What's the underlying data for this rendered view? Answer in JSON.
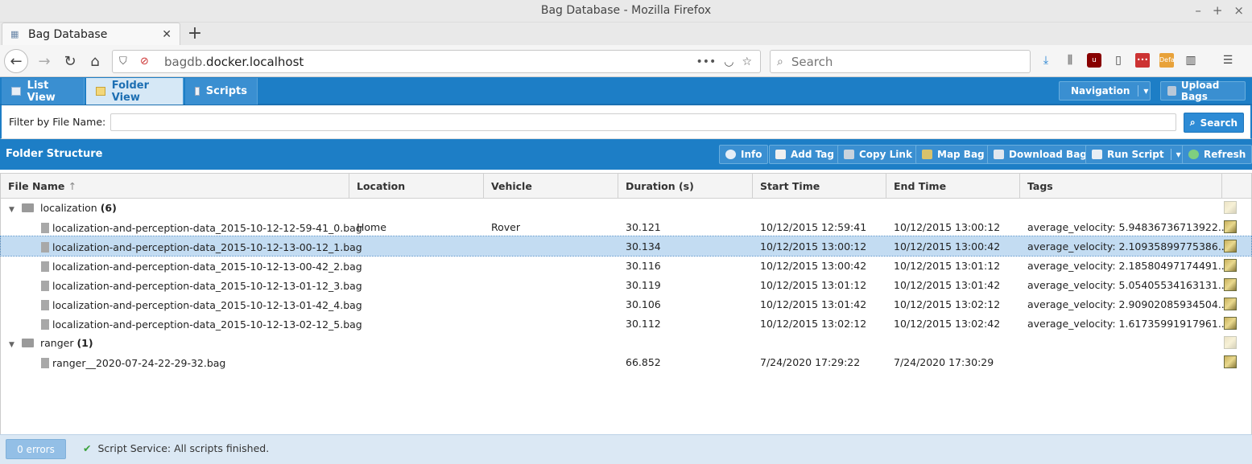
{
  "window": {
    "title": "Bag Database - Mozilla Firefox"
  },
  "browser": {
    "tab_label": "Bag Database",
    "url_prefix": "bagdb.",
    "url_domain": "docker.localhost",
    "search_placeholder": "Search",
    "ext_badge": "Defa"
  },
  "app": {
    "tabs": [
      {
        "label": "List View",
        "icon": "list-icon"
      },
      {
        "label": "Folder View",
        "icon": "folder-icon"
      },
      {
        "label": "Scripts",
        "icon": "script-icon"
      }
    ],
    "navigation_label": "Navigation",
    "upload_label": "Upload Bags"
  },
  "filter": {
    "label": "Filter by File Name:",
    "value": "",
    "search_label": "Search"
  },
  "folder": {
    "title": "Folder Structure",
    "buttons": {
      "info": "Info",
      "add_tag": "Add Tag",
      "copy_link": "Copy Link",
      "map_bag": "Map Bag",
      "download_bag": "Download Bag",
      "run_script": "Run Script",
      "refresh": "Refresh"
    }
  },
  "grid": {
    "columns": [
      "File Name",
      "Location",
      "Vehicle",
      "Duration (s)",
      "Start Time",
      "End Time",
      "Tags"
    ],
    "groups": [
      {
        "name": "localization",
        "count": "(6)",
        "rows": [
          {
            "file": "localization-and-perception-data_2015-10-12-12-59-41_0.bag",
            "location": "Home",
            "vehicle": "Rover",
            "duration": "30.121",
            "start": "10/12/2015 12:59:41",
            "end": "10/12/2015 13:00:12",
            "tags": "average_velocity: 5.94836736713922..."
          },
          {
            "file": "localization-and-perception-data_2015-10-12-13-00-12_1.bag",
            "location": "",
            "vehicle": "",
            "duration": "30.134",
            "start": "10/12/2015 13:00:12",
            "end": "10/12/2015 13:00:42",
            "tags": "average_velocity: 2.10935899775386..."
          },
          {
            "file": "localization-and-perception-data_2015-10-12-13-00-42_2.bag",
            "location": "",
            "vehicle": "",
            "duration": "30.116",
            "start": "10/12/2015 13:00:42",
            "end": "10/12/2015 13:01:12",
            "tags": "average_velocity: 2.18580497174491..."
          },
          {
            "file": "localization-and-perception-data_2015-10-12-13-01-12_3.bag",
            "location": "",
            "vehicle": "",
            "duration": "30.119",
            "start": "10/12/2015 13:01:12",
            "end": "10/12/2015 13:01:42",
            "tags": "average_velocity: 5.05405534163131..."
          },
          {
            "file": "localization-and-perception-data_2015-10-12-13-01-42_4.bag",
            "location": "",
            "vehicle": "",
            "duration": "30.106",
            "start": "10/12/2015 13:01:42",
            "end": "10/12/2015 13:02:12",
            "tags": "average_velocity: 2.90902085934504..."
          },
          {
            "file": "localization-and-perception-data_2015-10-12-13-02-12_5.bag",
            "location": "",
            "vehicle": "",
            "duration": "30.112",
            "start": "10/12/2015 13:02:12",
            "end": "10/12/2015 13:02:42",
            "tags": "average_velocity: 1.61735991917961..."
          }
        ]
      },
      {
        "name": "ranger",
        "count": "(1)",
        "rows": [
          {
            "file": "ranger__2020-07-24-22-29-32.bag",
            "location": "",
            "vehicle": "",
            "duration": "66.852",
            "start": "7/24/2020 17:29:22",
            "end": "7/24/2020 17:30:29",
            "tags": ""
          }
        ]
      }
    ]
  },
  "status": {
    "errors_label": "0 errors",
    "message": "Script Service: All scripts finished."
  },
  "colors": {
    "accent": "#1d7ec6",
    "selected_row": "#c3dcf2",
    "status_bg": "#dbe8f4"
  }
}
